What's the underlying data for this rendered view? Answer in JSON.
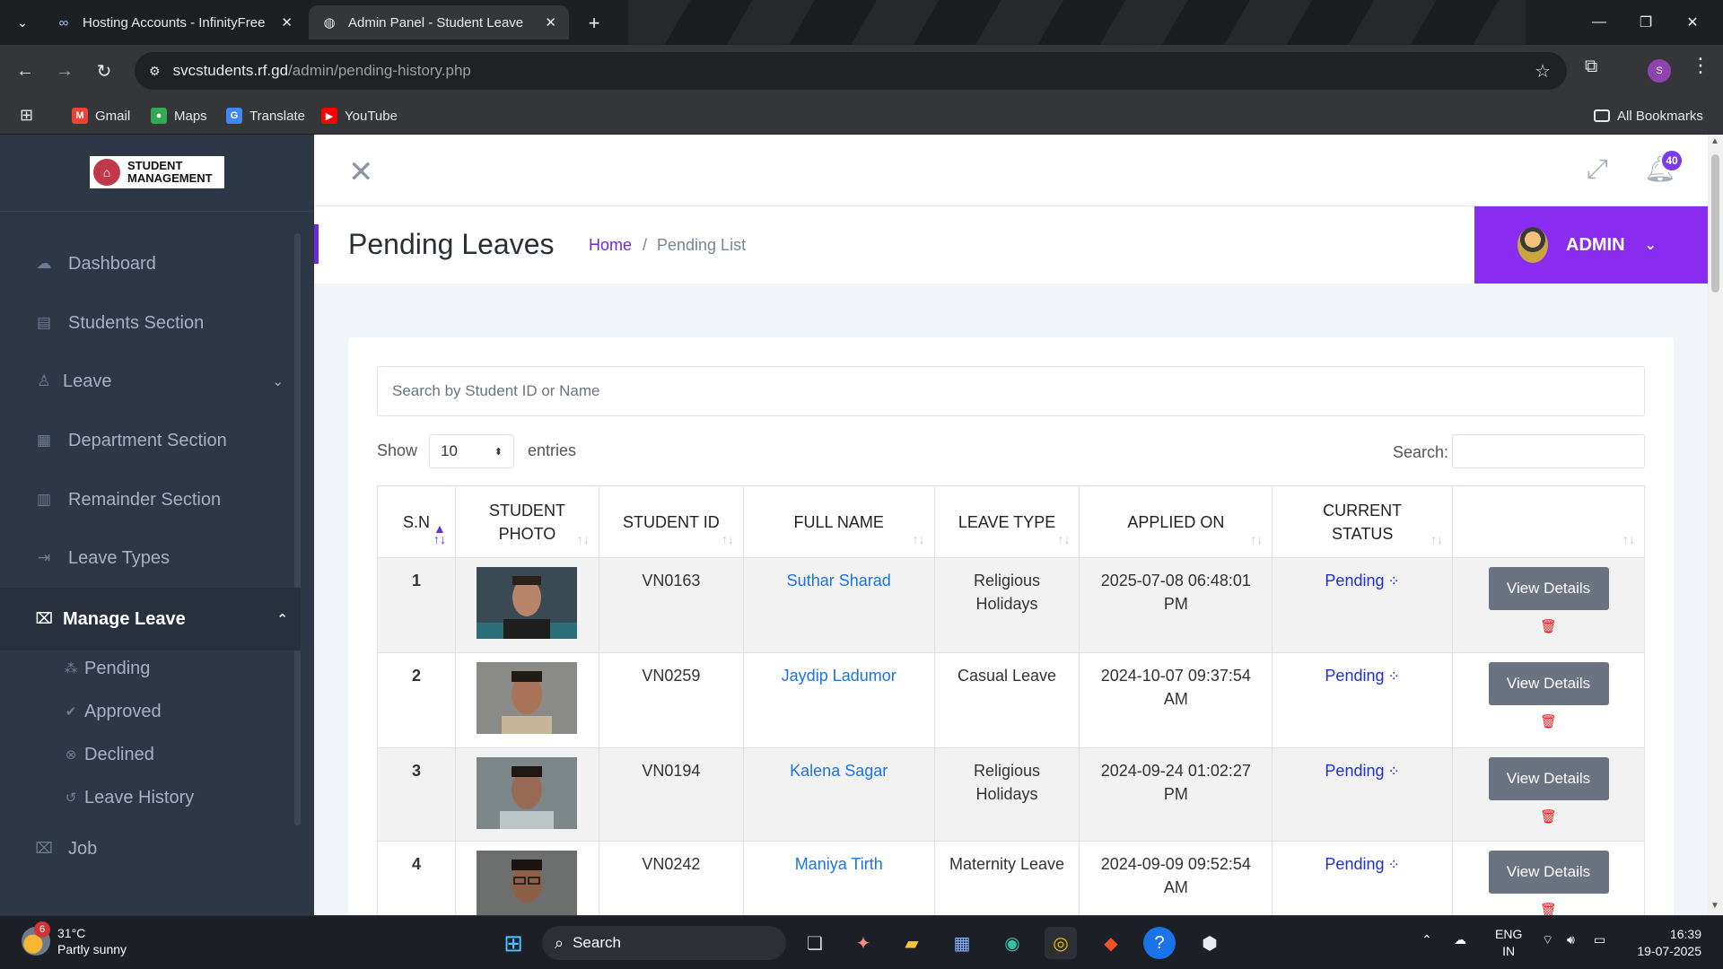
{
  "browser": {
    "tabs": [
      {
        "title": "Hosting Accounts - InfinityFree",
        "icon": "infinity-icon",
        "active": false
      },
      {
        "title": "Admin Panel - Student Leave",
        "icon": "globe-icon",
        "active": true
      }
    ],
    "url_host": "svcstudents.rf.gd",
    "url_path": "/admin/pending-history.php",
    "profile_initial": "S",
    "bookmarks": [
      {
        "label": "Gmail",
        "color": "#ea4335",
        "glyph": "M"
      },
      {
        "label": "Maps",
        "color": "#34a853",
        "glyph": "●"
      },
      {
        "label": "Translate",
        "color": "#4285f4",
        "glyph": "G"
      },
      {
        "label": "YouTube",
        "color": "#ff0000",
        "glyph": "▶"
      }
    ],
    "all_bookmarks": "All Bookmarks"
  },
  "sidebar": {
    "logo_line1": "STUDENT",
    "logo_line2": "MANAGEMENT",
    "items": [
      {
        "label": "Dashboard",
        "icon": "cloud-icon"
      },
      {
        "label": "Students Section",
        "icon": "id-card-icon"
      },
      {
        "label": "Leave",
        "icon": "user-icon"
      },
      {
        "label": "Department Section",
        "icon": "grid-icon"
      },
      {
        "label": "Remainder Section",
        "icon": "calendar-icon"
      },
      {
        "label": "Leave Types",
        "icon": "sign-out-icon"
      },
      {
        "label": "Manage Leave",
        "icon": "briefcase-icon"
      },
      {
        "label": "Job",
        "icon": "briefcase-icon"
      }
    ],
    "sub_items": [
      {
        "label": "Pending",
        "icon": "spinner-icon"
      },
      {
        "label": "Approved",
        "icon": "check-icon"
      },
      {
        "label": "Declined",
        "icon": "x-circle-icon"
      },
      {
        "label": "Leave History",
        "icon": "history-icon"
      }
    ]
  },
  "header": {
    "notification_count": "40",
    "page_title": "Pending Leaves",
    "breadcrumb_home": "Home",
    "breadcrumb_sep": "/",
    "breadcrumb_current": "Pending List",
    "admin_label": "ADMIN"
  },
  "main": {
    "search_placeholder": "Search by Student ID or Name",
    "show_label": "Show",
    "entries_value": "10",
    "entries_label": "entries",
    "search_label": "Search:",
    "columns": [
      "S.N",
      "STUDENT PHOTO",
      "STUDENT ID",
      "FULL NAME",
      "LEAVE TYPE",
      "APPLIED ON",
      "CURRENT STATUS",
      ""
    ],
    "rows": [
      {
        "sn": "1",
        "id": "VN0163",
        "name": "Suthar Sharad",
        "leave_type": "Religious Holidays",
        "applied": "2025-07-08 06:48:01 PM",
        "status": "Pending",
        "action": "View Details"
      },
      {
        "sn": "2",
        "id": "VN0259",
        "name": "Jaydip Ladumor",
        "leave_type": "Casual Leave",
        "applied": "2024-10-07 09:37:54 AM",
        "status": "Pending",
        "action": "View Details"
      },
      {
        "sn": "3",
        "id": "VN0194",
        "name": "Kalena Sagar",
        "leave_type": "Religious Holidays",
        "applied": "2024-09-24 01:02:27 PM",
        "status": "Pending",
        "action": "View Details"
      },
      {
        "sn": "4",
        "id": "VN0242",
        "name": "Maniya Tirth",
        "leave_type": "Maternity Leave",
        "applied": "2024-09-09 09:52:54 AM",
        "status": "Pending",
        "action": "View Details"
      }
    ]
  },
  "taskbar": {
    "weather_badge": "6",
    "temperature": "31°C",
    "condition": "Partly sunny",
    "search_label": "Search",
    "lang_line1": "ENG",
    "lang_line2": "IN",
    "time": "16:39",
    "date": "19-07-2025"
  }
}
